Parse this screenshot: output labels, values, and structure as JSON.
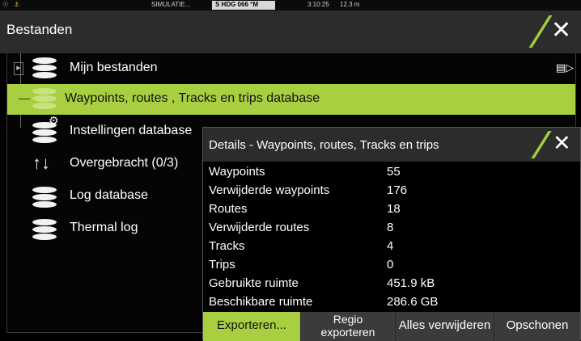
{
  "status_bar": {
    "sim_label": "SIMULATIE...",
    "heading": "S HDG 066 °M",
    "time": "3:10:25",
    "distance": "12.3 m"
  },
  "title_bar": {
    "title": "Bestanden",
    "close_icon": "close-icon",
    "accent_color": "#9fcf3c"
  },
  "tree": {
    "items": [
      {
        "label": "Mijn bestanden",
        "icon": "database-icon",
        "expandable": true
      },
      {
        "label": "Waypoints, routes , Tracks en trips database",
        "icon": "database-icon",
        "selected": true
      },
      {
        "label": "Instellingen database",
        "icon": "database-settings-icon"
      },
      {
        "label": "Overgebracht (0/3)",
        "icon": "transfer-arrows-icon"
      },
      {
        "label": "Log database",
        "icon": "database-icon"
      },
      {
        "label": "Thermal log",
        "icon": "database-icon"
      }
    ],
    "selected_color": "#a7cf40"
  },
  "dialog": {
    "title": "Details - Waypoints, routes, Tracks en trips",
    "rows": [
      {
        "label": "Waypoints",
        "value": "55"
      },
      {
        "label": "Verwijderde waypoints",
        "value": "176"
      },
      {
        "label": "Routes",
        "value": "18"
      },
      {
        "label": "Verwijderde routes",
        "value": "8"
      },
      {
        "label": "Tracks",
        "value": "4"
      },
      {
        "label": "Trips",
        "value": "0"
      },
      {
        "label": "Gebruikte ruimte",
        "value": "451.9 kB"
      },
      {
        "label": "Beschikbare ruimte",
        "value": "286.6 GB"
      }
    ],
    "buttons": {
      "export": "Exporteren...",
      "region_export_line1": "Regio",
      "region_export_line2": "exporteren",
      "delete_all": "Alles verwijderen",
      "clean": "Opschonen"
    },
    "active_button_color": "#a7cf40"
  }
}
